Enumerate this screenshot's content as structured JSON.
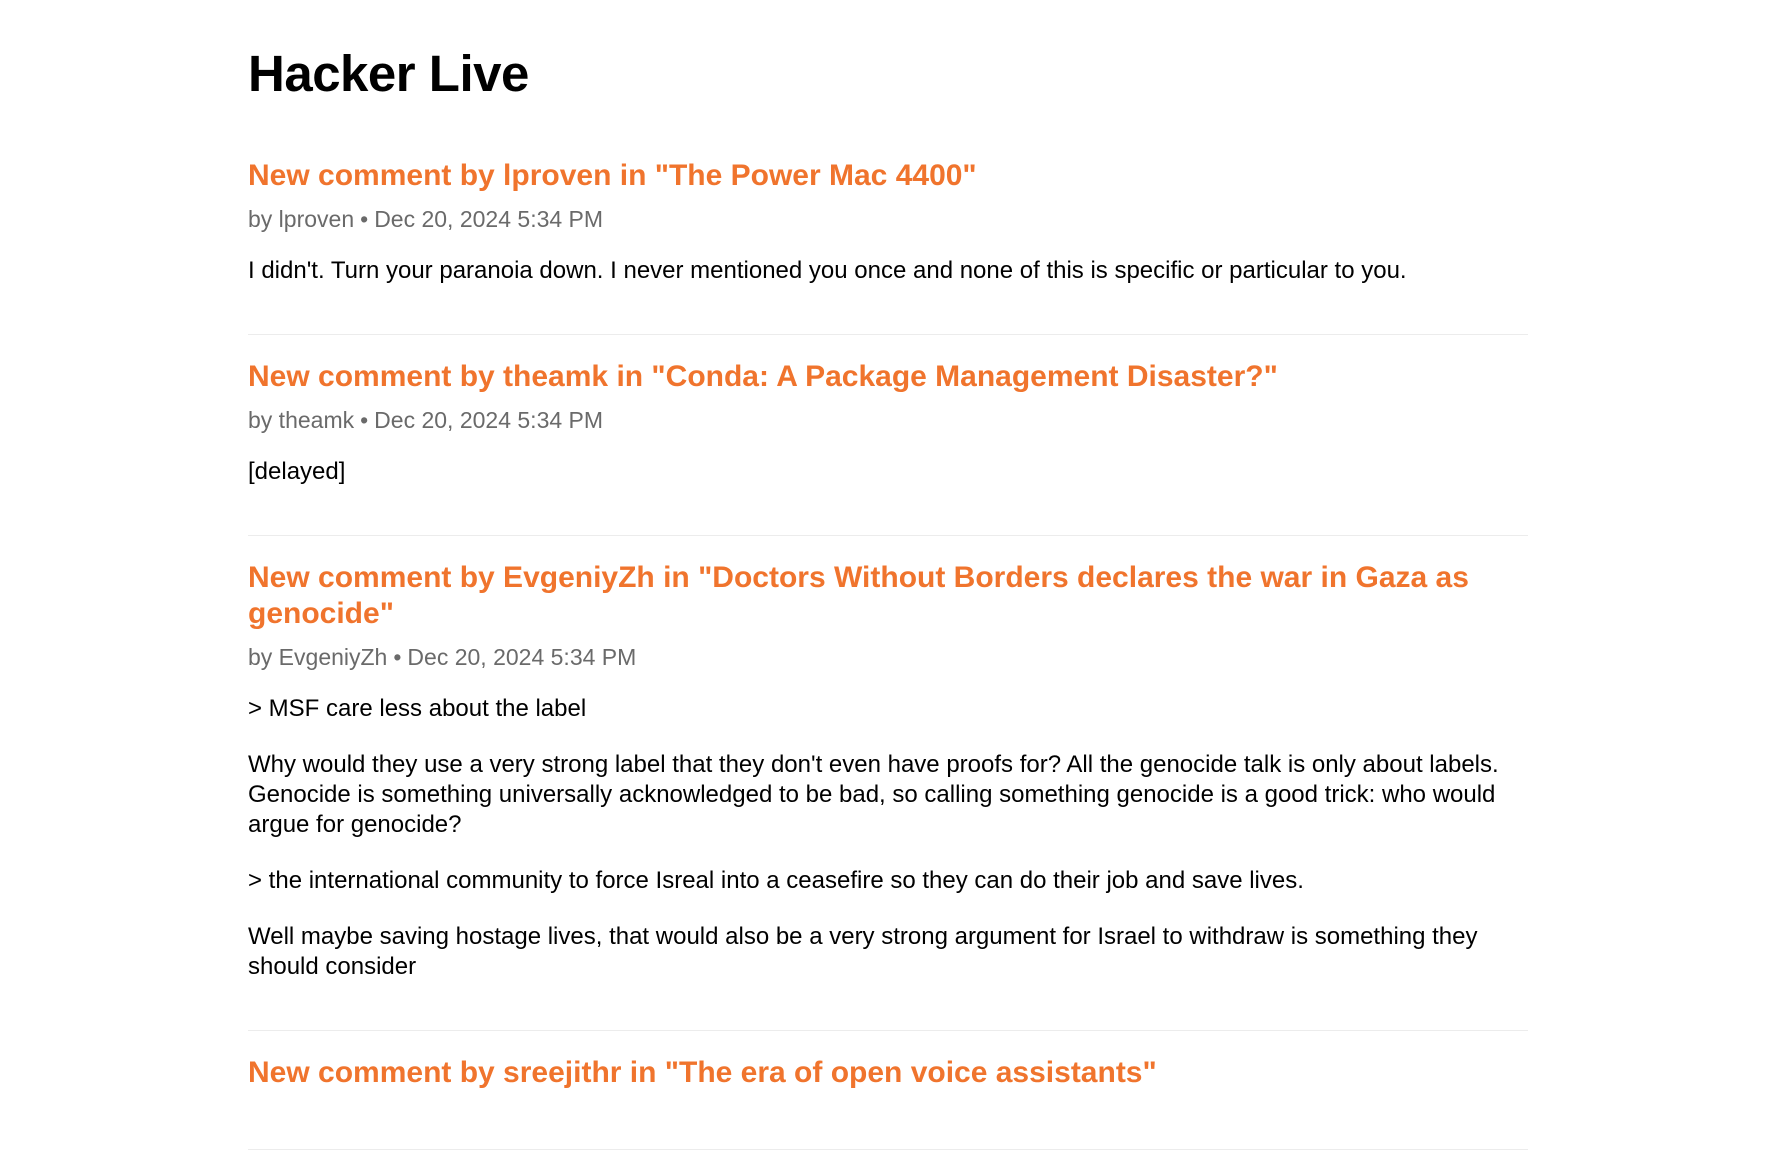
{
  "page": {
    "title": "Hacker Live"
  },
  "items": [
    {
      "title": "New comment by lproven in \"The Power Mac 4400\"",
      "author": "by lproven",
      "separator": "•",
      "timestamp": "Dec 20, 2024 5:34 PM",
      "paragraphs": [
        "I didn't. Turn your paranoia down. I never mentioned you once and none of this is specific or particular to you."
      ]
    },
    {
      "title": "New comment by theamk in \"Conda: A Package Management Disaster?\"",
      "author": "by theamk",
      "separator": "•",
      "timestamp": "Dec 20, 2024 5:34 PM",
      "paragraphs": [
        "[delayed]"
      ]
    },
    {
      "title": "New comment by EvgeniyZh in \"Doctors Without Borders declares the war in Gaza as genocide\"",
      "author": "by EvgeniyZh",
      "separator": "•",
      "timestamp": "Dec 20, 2024 5:34 PM",
      "paragraphs": [
        "> MSF care less about the label",
        "Why would they use a very strong label that they don't even have proofs for? All the genocide talk is only about labels. Genocide is something universally acknowledged to be bad, so calling something genocide is a good trick: who would argue for genocide?",
        "> the international community to force Isreal into a ceasefire so they can do their job and save lives.",
        "Well maybe saving hostage lives, that would also be a very strong argument for Israel to withdraw is something they should consider"
      ]
    },
    {
      "title": "New comment by sreejithr in \"The era of open voice assistants\"",
      "author": "",
      "separator": "",
      "timestamp": "",
      "paragraphs": []
    }
  ]
}
